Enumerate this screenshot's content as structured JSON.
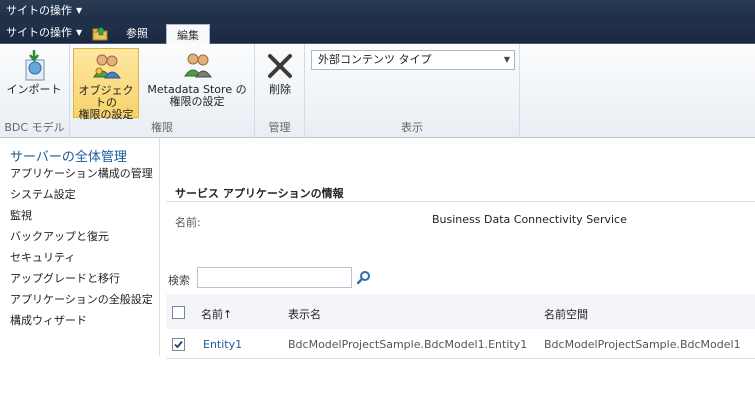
{
  "topbar": {
    "site_actions": "サイトの操作",
    "tab_browse": "参照",
    "tab_edit": "編集"
  },
  "ribbon": {
    "groups": {
      "bdc_model": "BDC モデル",
      "permissions": "権限",
      "manage": "管理",
      "view": "表示"
    },
    "import_label": "インポート",
    "object_perm_line1": "オブジェクトの",
    "object_perm_line2": "権限の設定",
    "metadata_perm_line1": "Metadata Store の",
    "metadata_perm_line2": "権限の設定",
    "delete_label": "削除",
    "view_dropdown": "外部コンテンツ タイプ"
  },
  "leftnav": {
    "header": "サーバーの全体管理",
    "items": [
      "アプリケーション構成の管理",
      "システム設定",
      "監視",
      "バックアップと復元",
      "セキュリティ",
      "アップグレードと移行",
      "アプリケーションの全般設定",
      "構成ウィザード"
    ]
  },
  "main": {
    "section_title": "サービス アプリケーションの情報",
    "name_label": "名前:",
    "name_value": "Business Data Connectivity Service",
    "search_label": "検索",
    "columns": {
      "name": "名前↑",
      "display_name": "表示名",
      "namespace": "名前空間"
    },
    "rows": [
      {
        "checked": true,
        "name": "Entity1",
        "display_name": "BdcModelProjectSample.BdcModel1.Entity1",
        "namespace": "BdcModelProjectSample.BdcModel1"
      }
    ]
  },
  "colors": {
    "topbar": "#1e2d44",
    "link": "#1a5a9a",
    "active_button": "#f8d36b"
  }
}
